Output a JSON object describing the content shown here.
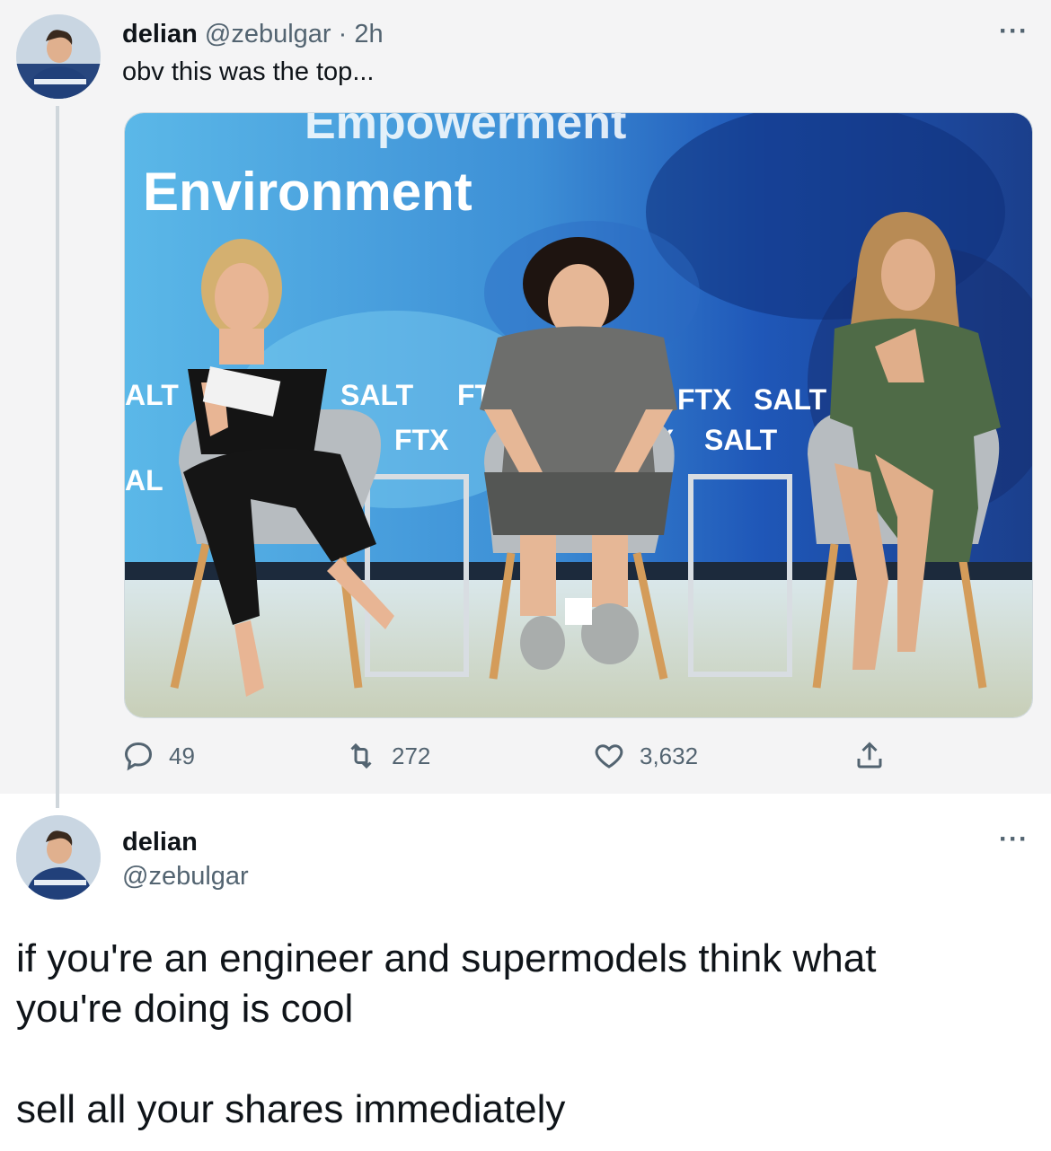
{
  "tweet1": {
    "name": "delian",
    "handle": "@zebulgar",
    "separator": "·",
    "time": "2h",
    "text": "obv this was the top...",
    "more_label": "···",
    "media": {
      "banner_top": "Empowerment",
      "banner_title": "Environment",
      "logos": [
        "SALT",
        "FTX",
        "SALT",
        "FTX",
        "SALT",
        "FTX",
        "ALT",
        "AL",
        "X"
      ]
    },
    "actions": {
      "replies": "49",
      "retweets": "272",
      "likes": "3,632"
    }
  },
  "tweet2": {
    "name": "delian",
    "handle": "@zebulgar",
    "more_label": "···",
    "body_line1": "if you're an engineer and supermodels think what",
    "body_line2": "you're doing is cool",
    "body_line3": "sell all your shares immediately"
  },
  "colors": {
    "secondary_text": "#536471",
    "thread_line": "#cfd6db",
    "parent_bg": "#f4f4f5"
  }
}
